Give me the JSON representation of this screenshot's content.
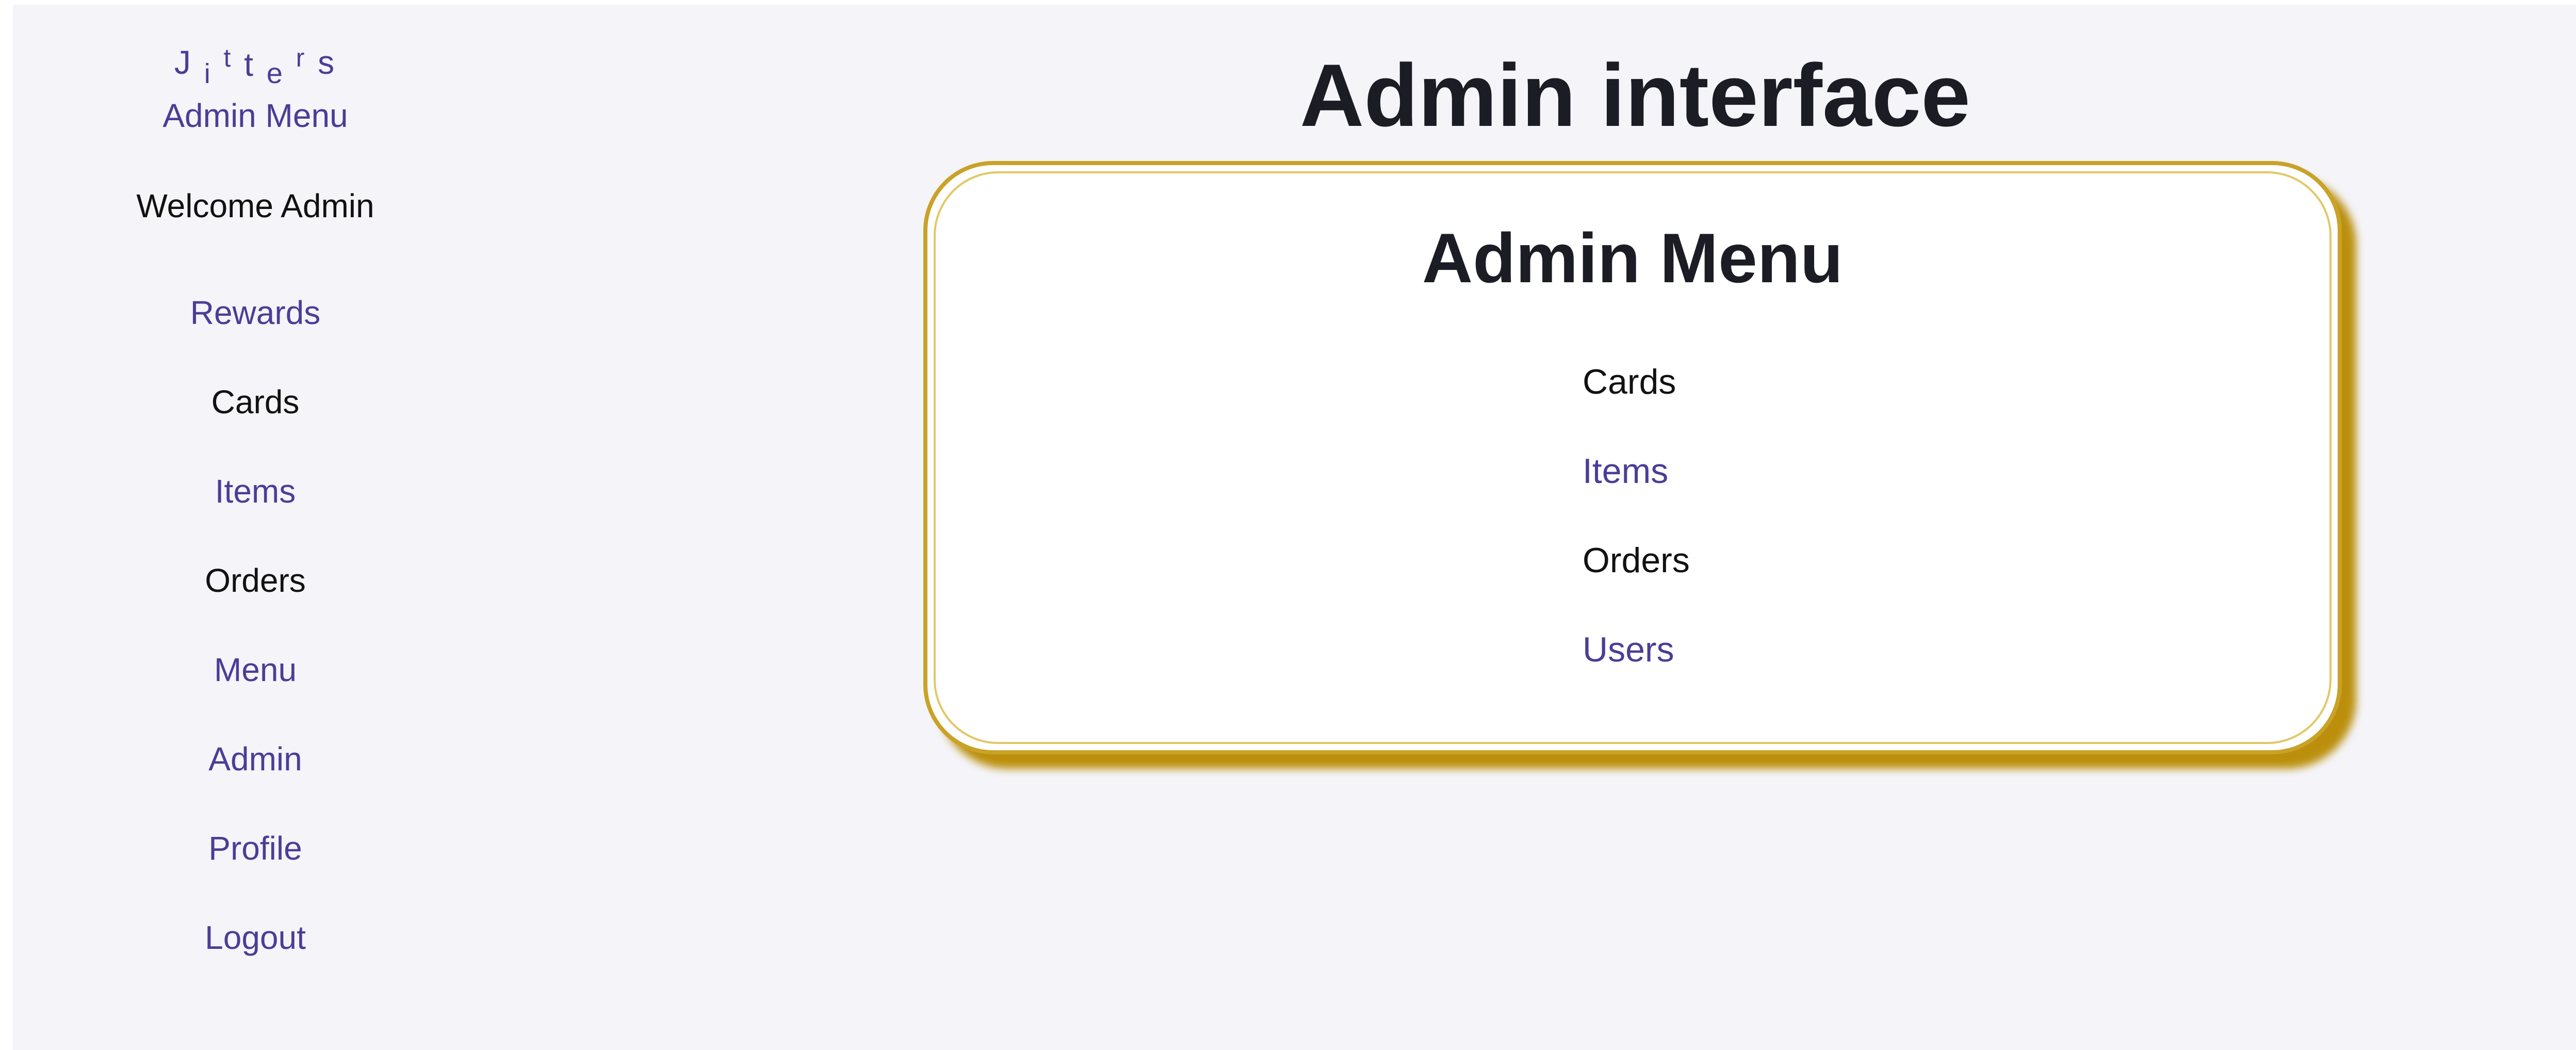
{
  "sidebar": {
    "logo": {
      "letters": [
        "J",
        "i",
        "t",
        "t",
        "e",
        "r",
        "s"
      ]
    },
    "admin_menu_label": "Admin Menu",
    "welcome_text": "Welcome Admin",
    "items": [
      {
        "label": "Rewards"
      },
      {
        "label": "Cards"
      },
      {
        "label": "Items"
      },
      {
        "label": "Orders"
      },
      {
        "label": "Menu"
      },
      {
        "label": "Admin"
      },
      {
        "label": "Profile"
      },
      {
        "label": "Logout"
      }
    ]
  },
  "main": {
    "title": "Admin interface",
    "card": {
      "title": "Admin Menu",
      "links": [
        {
          "label": "Cards"
        },
        {
          "label": "Items"
        },
        {
          "label": "Orders"
        },
        {
          "label": "Users"
        }
      ]
    }
  },
  "colors": {
    "link_purple": "#4b3d96",
    "text_dark": "#1c1c24",
    "card_border_gold": "#c9a227",
    "card_shadow_gold": "#b88a00",
    "page_background": "#f4f4f9"
  }
}
